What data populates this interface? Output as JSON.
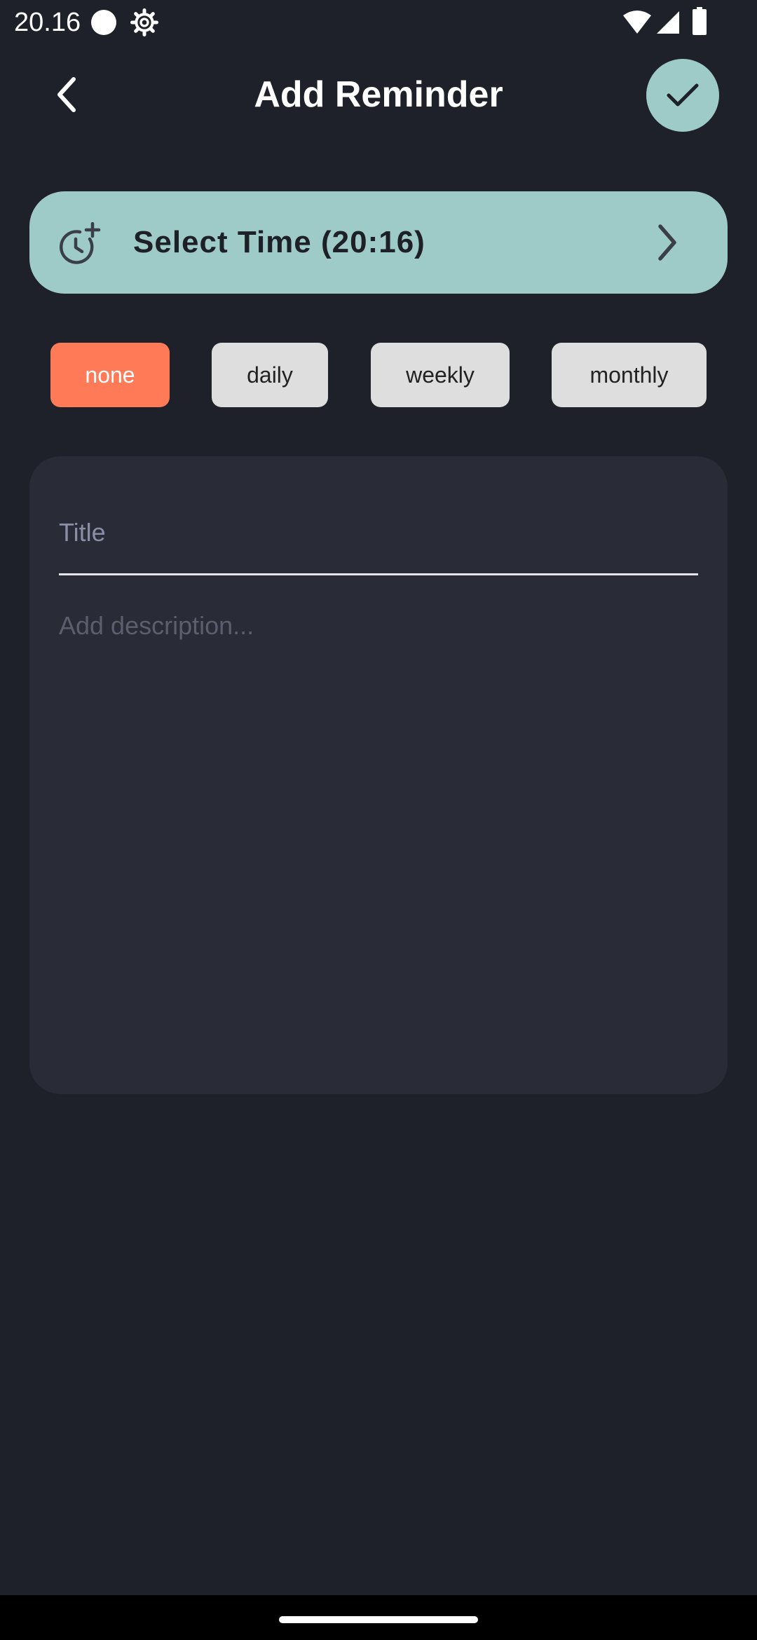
{
  "status_bar": {
    "time": "20.16",
    "icons": [
      "notification-dot-icon",
      "gear-icon",
      "wifi-icon",
      "signal-icon",
      "battery-icon"
    ]
  },
  "header": {
    "title": "Add Reminder",
    "back_icon": "chevron-left-icon",
    "save_icon": "check-icon"
  },
  "select_time": {
    "label": "Select Time (20:16)",
    "icon": "clock-plus-icon",
    "chevron": "chevron-right-icon"
  },
  "repeat": {
    "options": [
      "none",
      "daily",
      "weekly",
      "monthly"
    ],
    "selected": "none"
  },
  "form": {
    "title_placeholder": "Title",
    "title_value": "",
    "description_placeholder": "Add description...",
    "description_value": ""
  },
  "colors": {
    "background": "#1e212a",
    "card": "#292c36",
    "accent_teal": "#9ecbc8",
    "accent_orange": "#ff7b57",
    "chip_inactive": "#dedede"
  }
}
